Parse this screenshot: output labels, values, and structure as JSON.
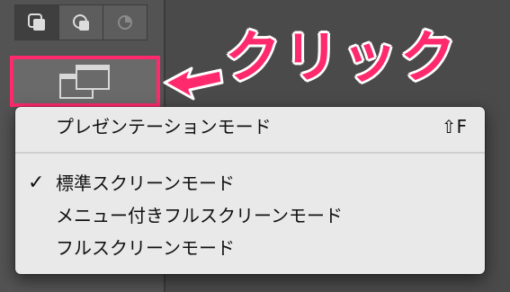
{
  "toolbar": {
    "mask_buttons": [
      {
        "icon": "mask-mode-standard-icon",
        "active": true
      },
      {
        "icon": "mask-mode-quick-icon",
        "active": false
      },
      {
        "icon": "mask-mode-disabled-icon",
        "active": false
      }
    ],
    "screen_mode_button": {
      "icon": "screen-mode-icon"
    }
  },
  "annotation": {
    "text": "クリック",
    "color": "#ff2a6d"
  },
  "menu": {
    "items": [
      {
        "label": "プレゼンテーションモード",
        "shortcut": "⇧F",
        "checked": false
      },
      {
        "label": "標準スクリーンモード",
        "shortcut": "",
        "checked": true,
        "check_mark": "✓"
      },
      {
        "label": "メニュー付きフルスクリーンモード",
        "shortcut": "",
        "checked": false
      },
      {
        "label": "フルスクリーンモード",
        "shortcut": "",
        "checked": false
      }
    ]
  }
}
